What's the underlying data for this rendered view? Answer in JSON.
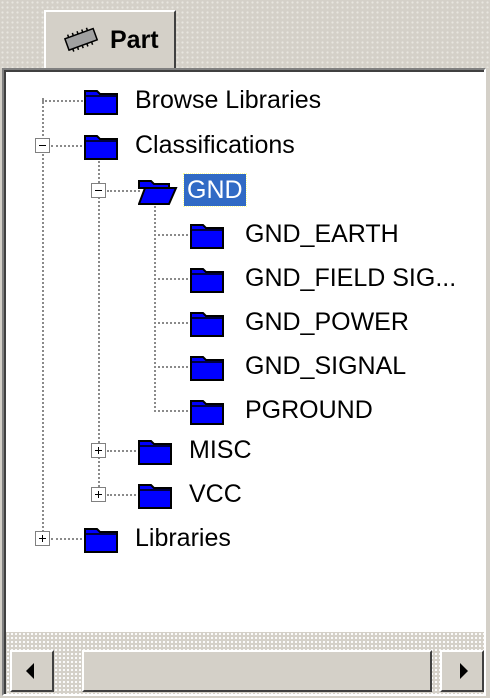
{
  "tab": {
    "label": "Part",
    "icon": "part-chip-icon"
  },
  "tree": {
    "browse_libraries": "Browse Libraries",
    "classifications": "Classifications",
    "gnd": "GND",
    "gnd_earth": "GND_EARTH",
    "gnd_field_sig": "GND_FIELD SIG...",
    "gnd_power": "GND_POWER",
    "gnd_signal": "GND_SIGNAL",
    "pground": "PGROUND",
    "misc": "MISC",
    "vcc": "VCC",
    "libraries": "Libraries",
    "selected_item": "GND"
  },
  "icons": {
    "folder_closed": "folder-closed-icon",
    "folder_open": "folder-open-icon",
    "expand": "expand-plus-icon",
    "collapse": "collapse-minus-icon"
  },
  "colors": {
    "window_bg": "#d4d0c8",
    "tree_bg": "#ffffff",
    "folder_blue": "#0000ff",
    "selection": "#316ac5"
  }
}
